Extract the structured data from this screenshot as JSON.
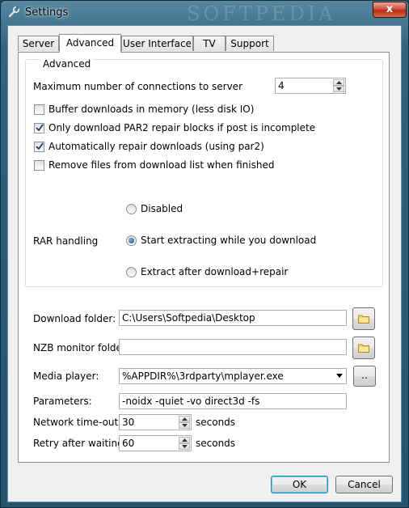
{
  "window": {
    "title": "Settings",
    "watermark": "SOFTPEDIA",
    "close_glyph": "x"
  },
  "tabs": [
    {
      "label": "Server",
      "active": false
    },
    {
      "label": "Advanced",
      "active": true
    },
    {
      "label": "User Interface",
      "active": false
    },
    {
      "label": "TV",
      "active": false
    },
    {
      "label": "Support",
      "active": false
    }
  ],
  "advanced": {
    "group_label": "Advanced",
    "max_connections_label": "Maximum number of connections to server",
    "max_connections_value": "4",
    "checkboxes": [
      {
        "label": "Buffer downloads in memory (less disk IO)",
        "checked": false
      },
      {
        "label": "Only download PAR2 repair blocks if post is incomplete",
        "checked": true
      },
      {
        "label": "Automatically repair downloads (using par2)",
        "checked": true
      },
      {
        "label": "Remove files from download list when finished",
        "checked": false
      }
    ]
  },
  "rar": {
    "label": "RAR handling",
    "options": [
      {
        "label": "Disabled",
        "selected": false
      },
      {
        "label": "Start extracting while you download",
        "selected": true
      },
      {
        "label": "Extract after download+repair",
        "selected": false
      }
    ]
  },
  "paths": {
    "download_folder_label": "Download folder:",
    "download_folder_value": "C:\\Users\\Softpedia\\Desktop",
    "nzb_monitor_label": "NZB monitor folder:",
    "nzb_monitor_value": "",
    "media_player_label": "Media player:",
    "media_player_value": "%APPDIR%\\3rdparty\\mplayer.exe",
    "media_browse_label": "..",
    "parameters_label": "Parameters:",
    "parameters_value": "-noidx -quiet -vo direct3d -fs",
    "network_timeout_label": "Network time-out:",
    "network_timeout_value": "30",
    "network_timeout_unit": "seconds",
    "retry_label": "Retry after waiting:",
    "retry_value": "60",
    "retry_unit": "seconds"
  },
  "footer": {
    "ok_label": "OK",
    "cancel_label": "Cancel"
  },
  "icons": {
    "title": "wrench-icon",
    "folder": "folder-icon",
    "dropdown": "chevron-down-icon"
  }
}
